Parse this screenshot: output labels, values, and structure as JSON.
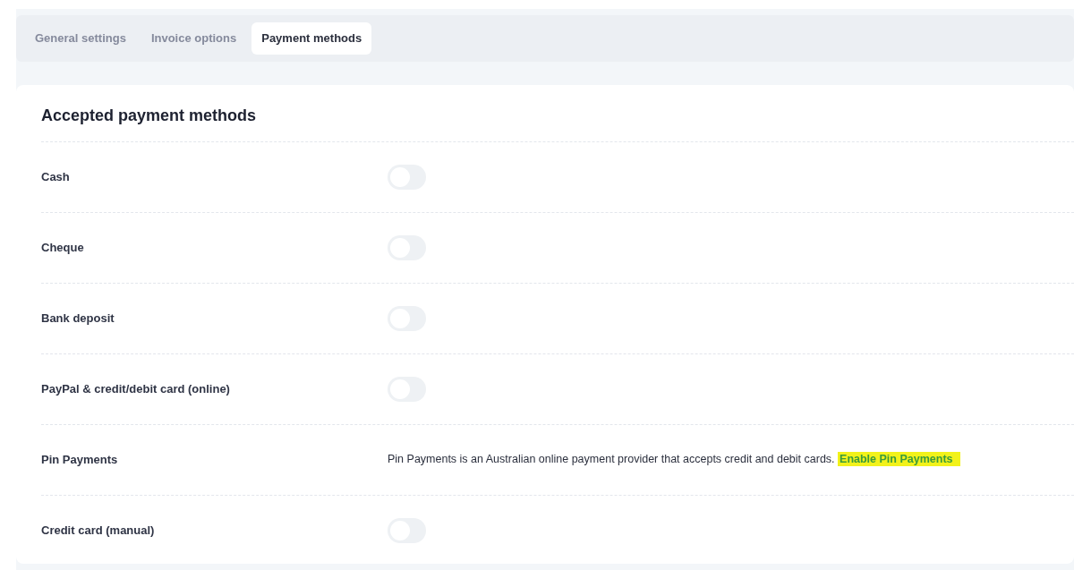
{
  "tabs": [
    {
      "label": "General settings",
      "selected": false
    },
    {
      "label": "Invoice options",
      "selected": false
    },
    {
      "label": "Payment methods",
      "selected": true
    }
  ],
  "section": {
    "title": "Accepted payment methods"
  },
  "methods": [
    {
      "name": "Cash",
      "kind": "toggle",
      "on": false
    },
    {
      "name": "Cheque",
      "kind": "toggle",
      "on": false
    },
    {
      "name": "Bank deposit",
      "kind": "toggle",
      "on": false
    },
    {
      "name": "PayPal & credit/debit card (online)",
      "kind": "toggle",
      "on": false
    },
    {
      "name": "Pin Payments",
      "kind": "text",
      "description": "Pin Payments is an Australian online payment provider that accepts credit and debit cards.",
      "link": {
        "label": "Enable Pin Payments",
        "highlighted": true
      }
    },
    {
      "name": "Credit card (manual)",
      "kind": "toggle",
      "on": false
    }
  ]
}
